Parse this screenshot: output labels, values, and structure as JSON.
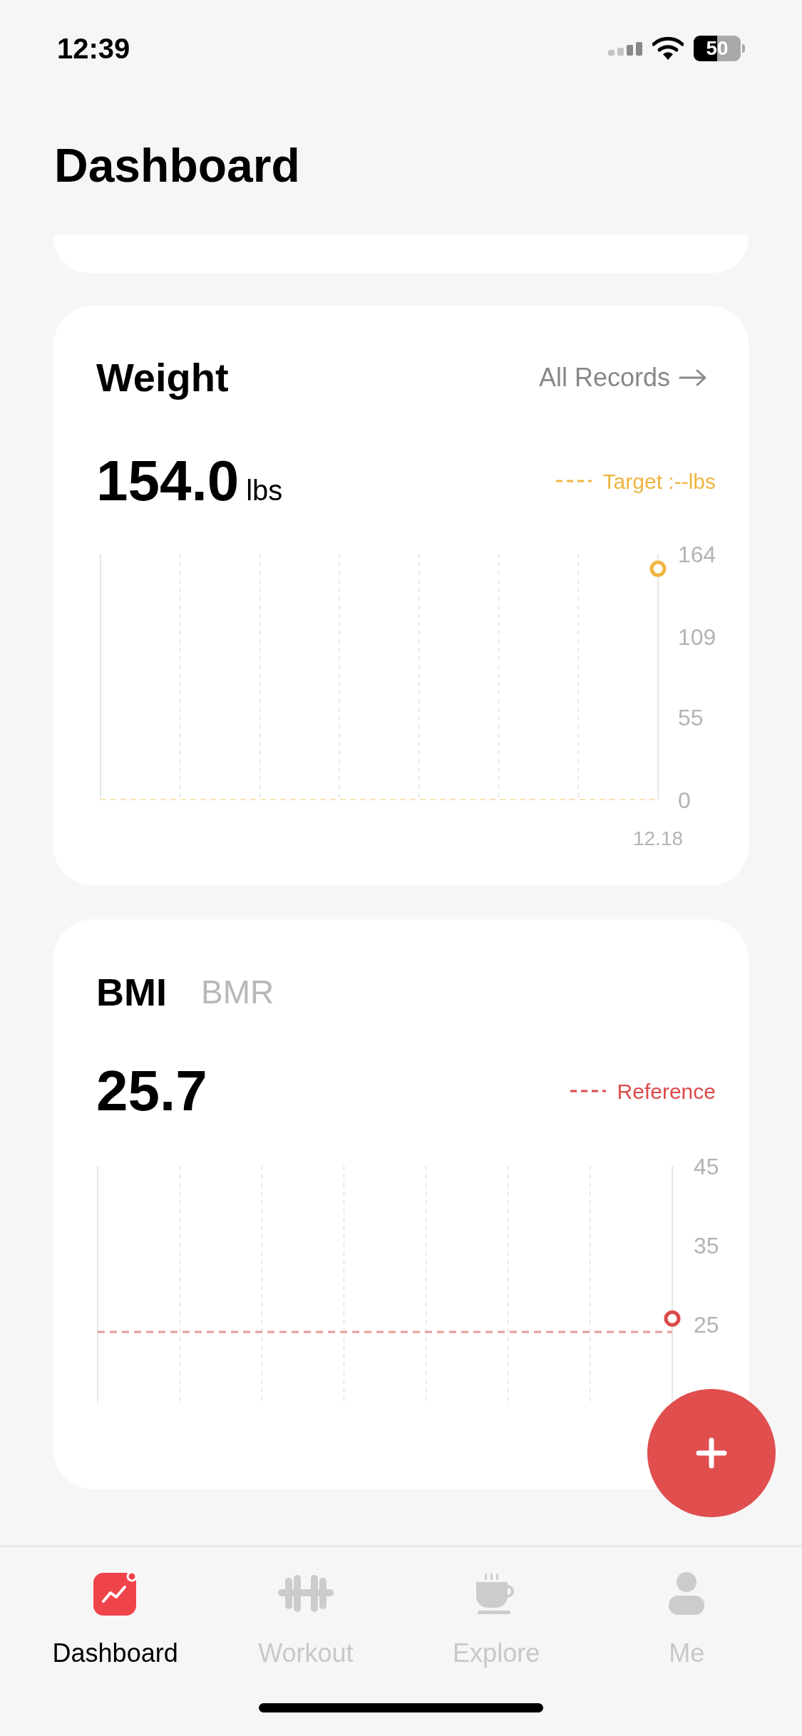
{
  "status_bar": {
    "time": "12:39",
    "battery": "50"
  },
  "title": "Dashboard",
  "weight_card": {
    "title": "Weight",
    "link": "All Records",
    "value": "154.0",
    "unit": "lbs",
    "legend": "Target :--lbs",
    "chart_data": {
      "type": "line",
      "x": [
        "12.18"
      ],
      "series": [
        {
          "color": "#f0b440",
          "marker": "circle",
          "values": [
            154.0
          ]
        }
      ],
      "ylim": [
        0,
        164
      ],
      "yticks": [
        0,
        55,
        109,
        164
      ]
    }
  },
  "bmi_card": {
    "tabs": [
      {
        "label": "BMI",
        "selected": true
      },
      {
        "label": "BMR",
        "selected": false
      }
    ],
    "value": "25.7",
    "legend": "Reference",
    "chart_data": {
      "type": "line",
      "series": [
        {
          "color": "#dc4a4a",
          "marker": "circle",
          "values": [
            25.7
          ]
        }
      ],
      "ylim": [
        15,
        45
      ],
      "yticks": [
        25,
        35,
        45
      ],
      "ref_lines": [
        {
          "axis": "y",
          "value": 24
        }
      ]
    }
  },
  "tab_bar": [
    {
      "kind": "dashboard",
      "label": "Dashboard",
      "selected": true
    },
    {
      "kind": "workout",
      "label": "Workout",
      "selected": false
    },
    {
      "kind": "explore",
      "label": "Explore",
      "selected": false
    },
    {
      "kind": "me",
      "label": "Me",
      "selected": false
    }
  ]
}
